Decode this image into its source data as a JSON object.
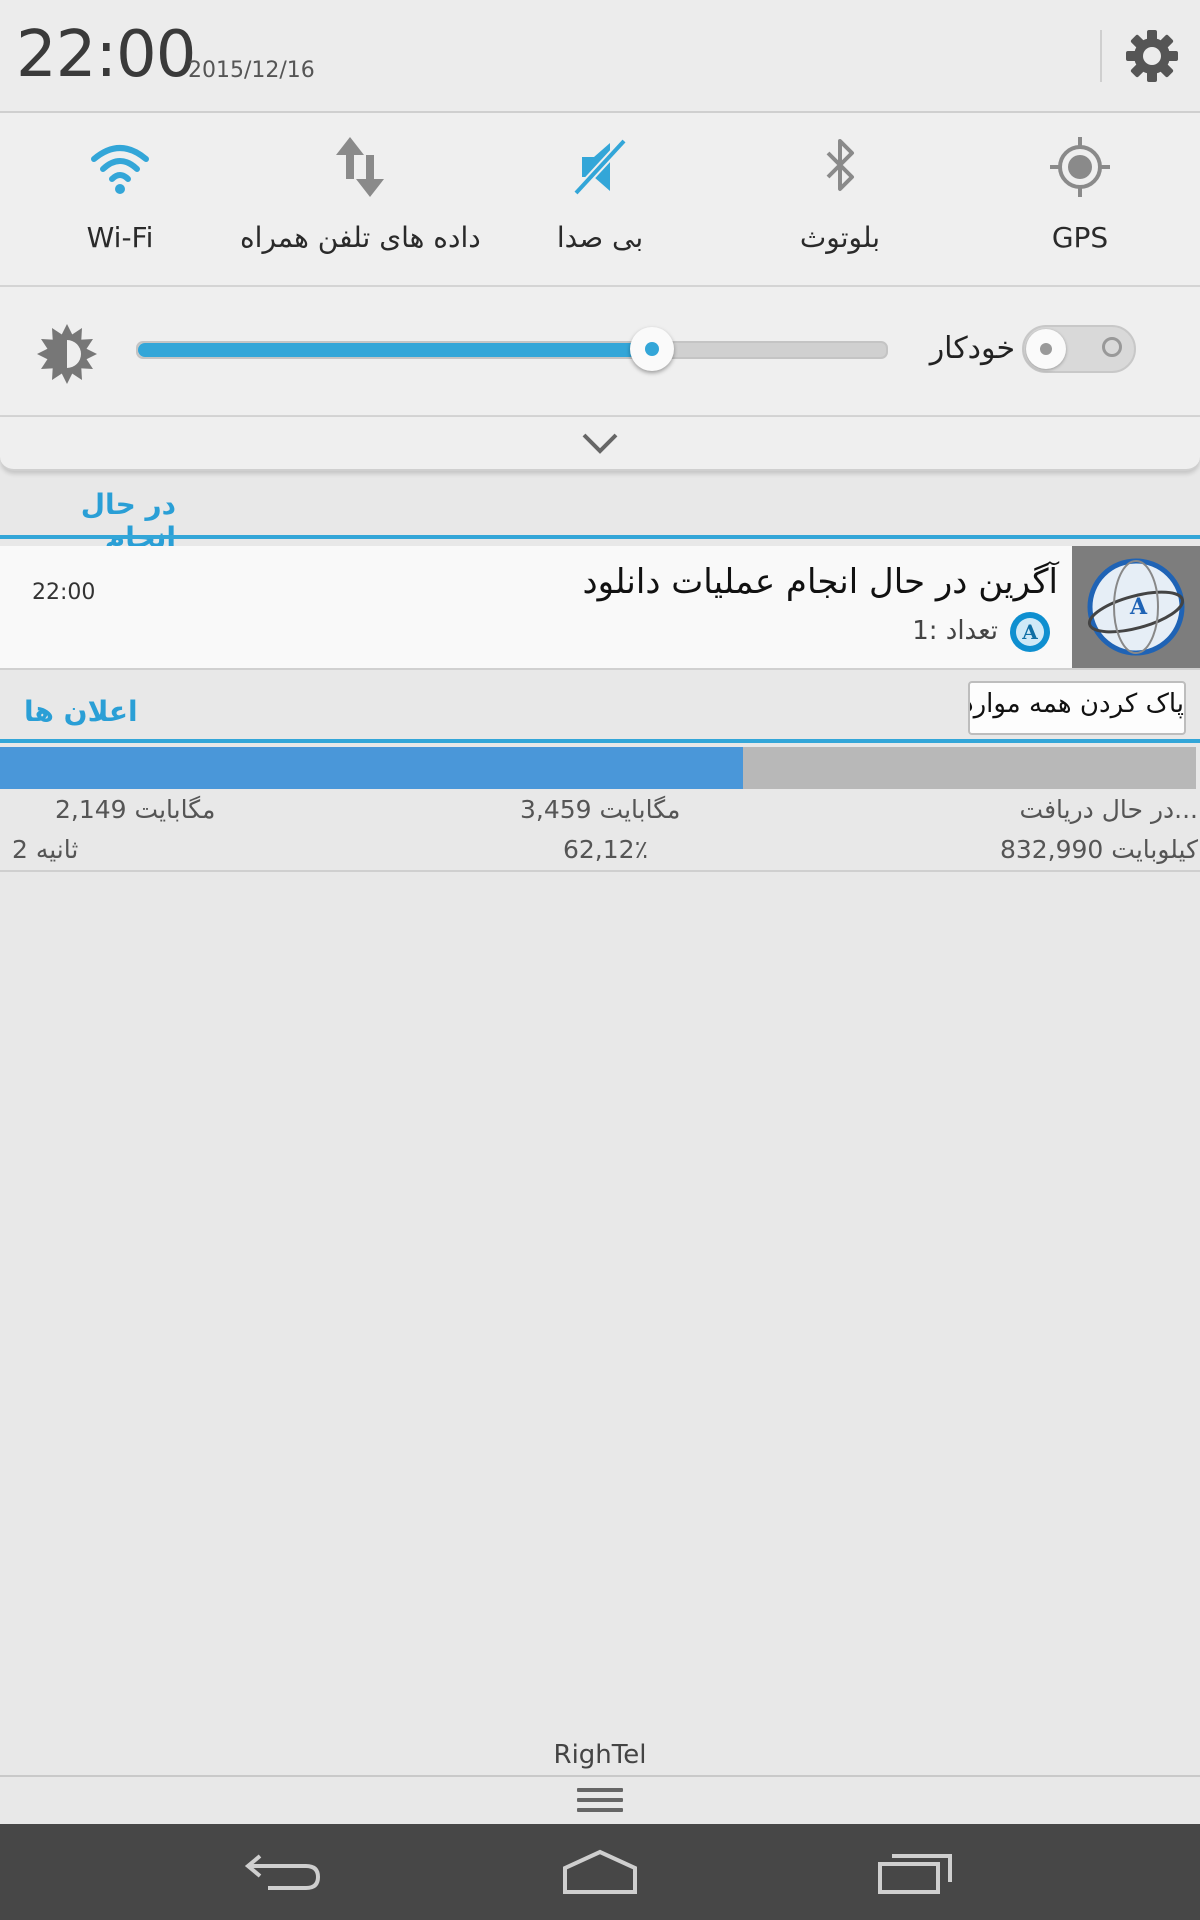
{
  "status": {
    "time": "22:00",
    "date": "2015/12/16"
  },
  "quick_settings": [
    {
      "label": "Wi-Fi",
      "icon": "wifi-icon",
      "active": true
    },
    {
      "label": "داده های تلفن همراه",
      "icon": "mobile-data-icon",
      "active": false
    },
    {
      "label": "بی صدا",
      "icon": "mute-icon",
      "active": true
    },
    {
      "label": "بلوتوث",
      "icon": "bluetooth-icon",
      "active": false
    },
    {
      "label": "GPS",
      "icon": "gps-icon",
      "active": false
    }
  ],
  "brightness": {
    "level": 0.69,
    "auto_label": "خودکار"
  },
  "ongoing": {
    "header": "در حال انجام",
    "notification": {
      "title": "آگرین در حال انجام عملیات دانلود",
      "count": "تعداد :1",
      "time": "22:00",
      "badge_letter": "A"
    }
  },
  "notifications": {
    "header": "اعلان ها",
    "clear_all": "پاک کردن همه موارد"
  },
  "download": {
    "progress": 0.6212,
    "downloaded": "2,149 مگابایت",
    "total": "3,459 مگابایت",
    "status": "در حال دریافت...",
    "time_left": "2 ثانیه",
    "percent": "62,12٪",
    "speed": "832,990 کیلوبایت"
  },
  "carrier": "RighTel",
  "colors": {
    "accent": "#33a6d8",
    "progress": "#4a97d9",
    "navbar": "#474747"
  }
}
